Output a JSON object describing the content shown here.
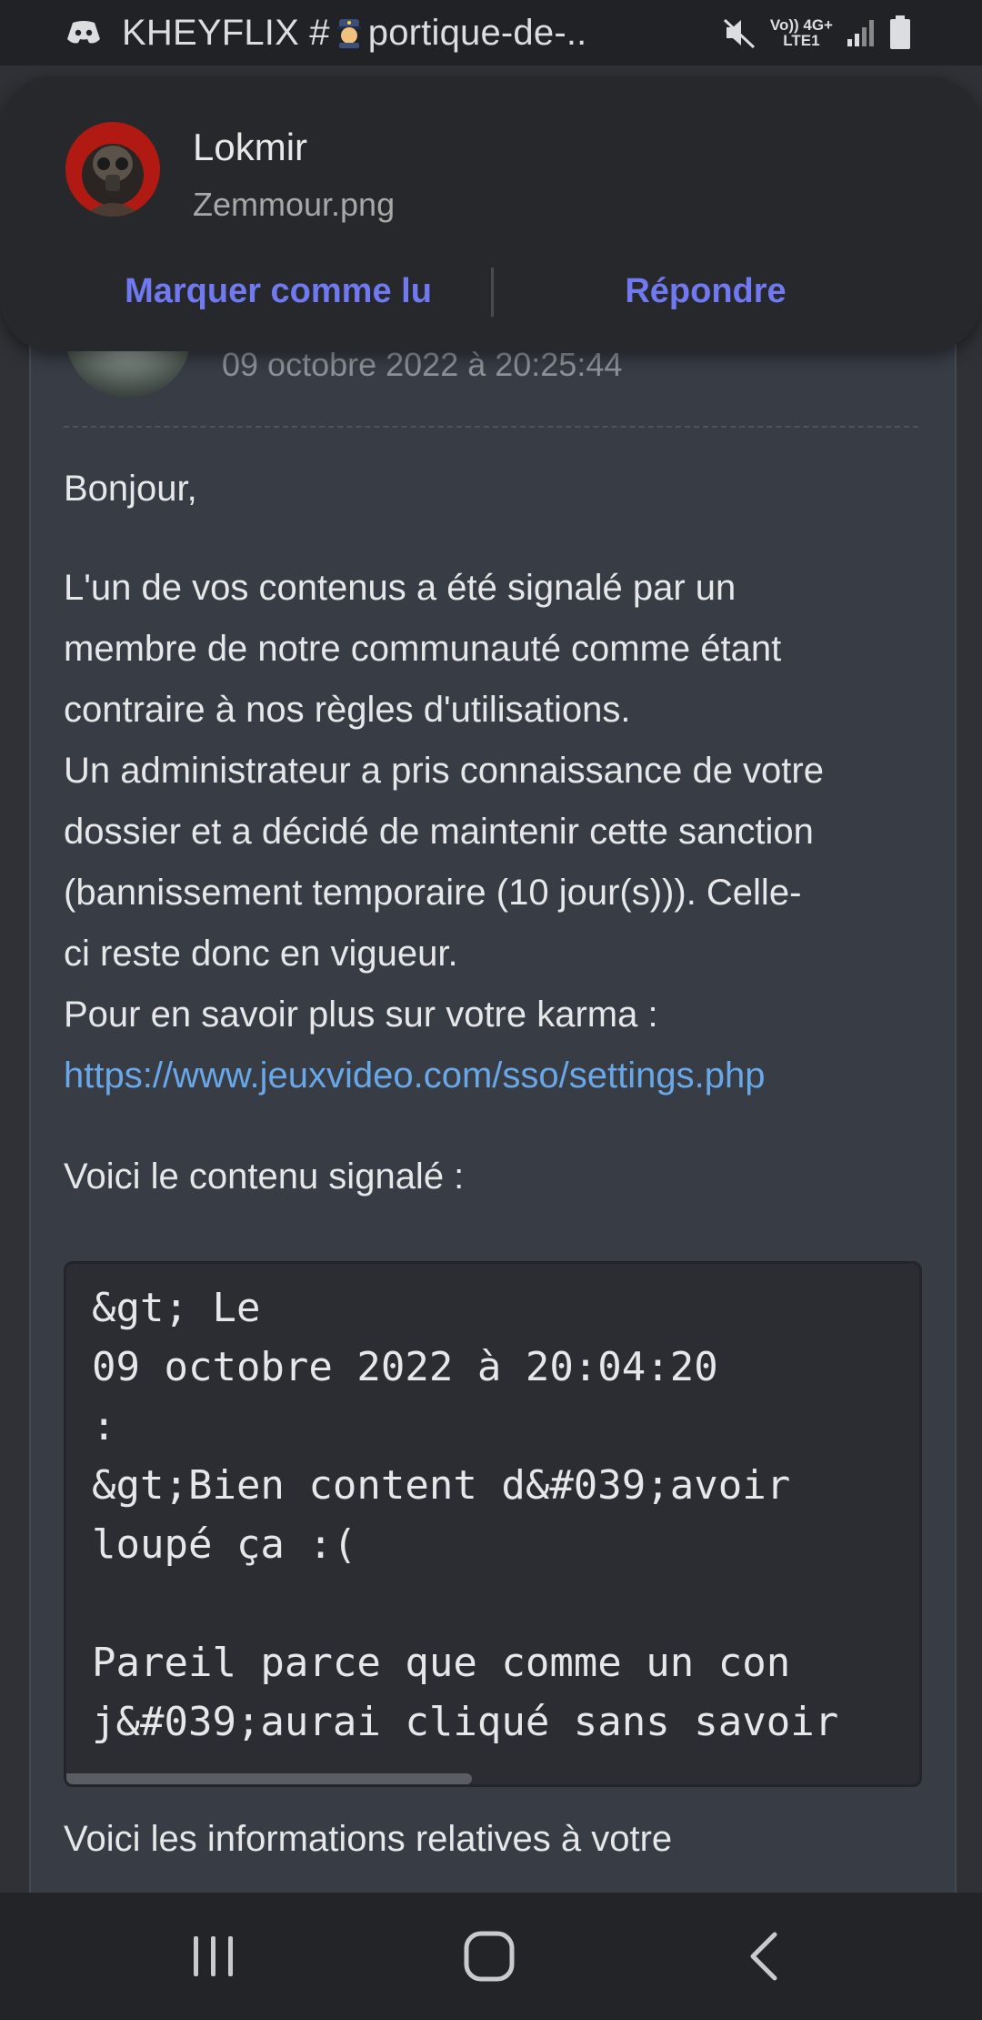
{
  "status_bar": {
    "title_prefix": "KHEYFLIX #",
    "title_suffix": "portique-de-..",
    "net_top": "Vo)) 4G+",
    "net_bottom": "LTE1"
  },
  "notification": {
    "sender": "Lokmir",
    "body": "Zemmour.png",
    "mark_read_label": "Marquer comme lu",
    "reply_label": "Répondre"
  },
  "message": {
    "timestamp": "09 octobre 2022 à 20:25:44",
    "greeting": "Bonjour,",
    "paragraph_lines": [
      "L'un de vos contenus a été signalé par un",
      "membre de notre communauté comme étant",
      "contraire à nos règles d'utilisations.",
      "Un administrateur a pris connaissance de votre",
      "dossier et a décidé de maintenir cette sanction",
      "(bannissement temporaire (10 jour(s))). Celle-",
      "ci reste donc en vigueur.",
      "Pour en savoir plus sur votre karma :"
    ],
    "link": "https://www.jeuxvideo.com/sso/settings.php",
    "reported_intro": "Voici le contenu signalé :",
    "code_lines": [
      "&gt; Le",
      "09 octobre 2022 à 20:04:20",
      ":",
      "&gt;Bien content d&#039;avoir",
      "loupé ça :(",
      "",
      "Pareil parce que comme un con",
      "j&#039;aurai cliqué sans savoir"
    ],
    "info_line": "Voici les informations relatives à votre"
  },
  "colors": {
    "accent": "#7179f0",
    "link": "#69a7e6",
    "card_bg": "#373c45",
    "code_bg": "#2b2d33"
  },
  "icons": {
    "app": "discord-icon",
    "status_emoji": "police-officer-emoji",
    "mute": "mute-icon",
    "signal": "signal-icon",
    "battery": "battery-icon",
    "nav_recents": "recents-icon",
    "nav_home": "home-icon",
    "nav_back": "back-icon"
  }
}
